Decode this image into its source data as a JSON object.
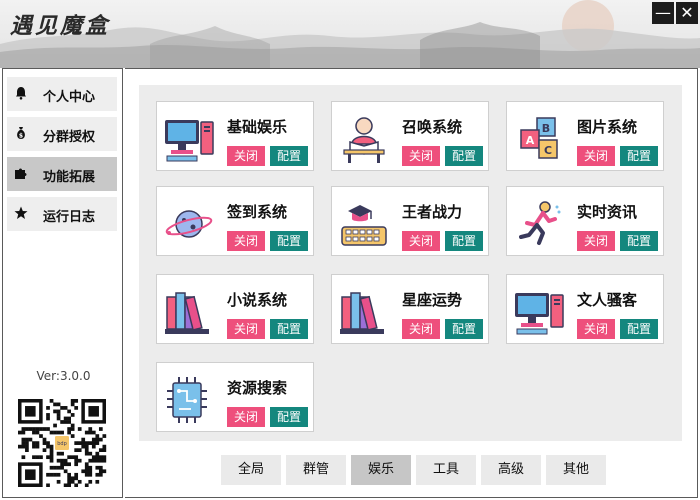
{
  "app": {
    "title": "遇见魔盒"
  },
  "window": {
    "minimize_symbol": "—",
    "close_symbol": "✕"
  },
  "sidebar": {
    "items": [
      {
        "label": "个人中心",
        "icon": "bell-icon"
      },
      {
        "label": "分群授权",
        "icon": "money-bag-icon"
      },
      {
        "label": "功能拓展",
        "icon": "puzzle-icon",
        "active": true
      },
      {
        "label": "运行日志",
        "icon": "star-icon"
      }
    ],
    "version": "Ver:3.0.0",
    "qr_badge": "bdp"
  },
  "features": [
    {
      "name": "基础娱乐",
      "icon": "computer-icon",
      "off_label": "关闭",
      "config_label": "配置"
    },
    {
      "name": "召唤系统",
      "icon": "reading-person-icon",
      "off_label": "关闭",
      "config_label": "配置"
    },
    {
      "name": "图片系统",
      "icon": "abc-blocks-icon",
      "off_label": "关闭",
      "config_label": "配置"
    },
    {
      "name": "签到系统",
      "icon": "planet-icon",
      "off_label": "关闭",
      "config_label": "配置"
    },
    {
      "name": "王者战力",
      "icon": "graduation-keyboard-icon",
      "off_label": "关闭",
      "config_label": "配置"
    },
    {
      "name": "实时资讯",
      "icon": "running-man-icon",
      "off_label": "关闭",
      "config_label": "配置"
    },
    {
      "name": "小说系统",
      "icon": "books-icon",
      "off_label": "关闭",
      "config_label": "配置"
    },
    {
      "name": "星座运势",
      "icon": "books-icon",
      "off_label": "关闭",
      "config_label": "配置"
    },
    {
      "name": "文人骚客",
      "icon": "computer-icon",
      "off_label": "关闭",
      "config_label": "配置"
    },
    {
      "name": "资源搜索",
      "icon": "chip-icon",
      "off_label": "关闭",
      "config_label": "配置"
    }
  ],
  "tabs": [
    {
      "label": "全局"
    },
    {
      "label": "群管"
    },
    {
      "label": "娱乐",
      "active": true
    },
    {
      "label": "工具"
    },
    {
      "label": "高级"
    },
    {
      "label": "其他"
    }
  ],
  "colors": {
    "off": "#ee4f7c",
    "config": "#14877e",
    "active_nav": "#c8c8c8"
  }
}
